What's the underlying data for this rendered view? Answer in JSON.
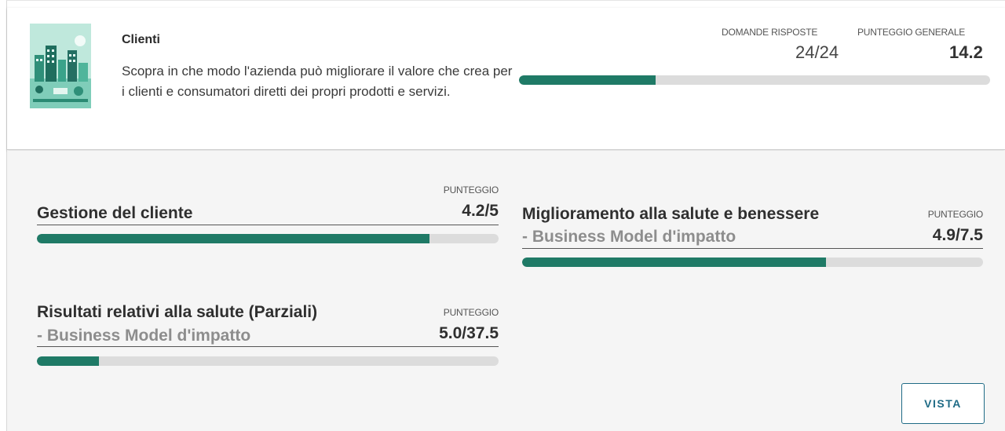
{
  "header": {
    "title": "Clienti",
    "description": "Scopra in che modo l'azienda può migliorare il valore che crea per i clienti e consumatori diretti dei propri prodotti e servizi.",
    "answered_label": "DOMANDE RISPOSTE",
    "answered_value": "24/24",
    "score_label": "PUNTEGGIO GENERALE",
    "score_value": "14.2",
    "progress_fraction": 0.29
  },
  "categories": [
    {
      "title": "Gestione del cliente",
      "subtitle": "",
      "score_label": "PUNTEGGIO",
      "score": "4.2/5",
      "progress_fraction": 0.85
    },
    {
      "title": "Miglioramento alla salute e benessere",
      "subtitle": " - Business Model d'impatto",
      "score_label": "PUNTEGGIO",
      "score": "4.9/7.5",
      "progress_fraction": 0.66
    },
    {
      "title": "Risultati relativi alla salute (Parziali)",
      "subtitle": " - Business Model d'impatto",
      "score_label": "PUNTEGGIO",
      "score": "5.0/37.5",
      "progress_fraction": 0.135
    }
  ],
  "actions": {
    "view_label": "VISTA"
  },
  "colors": {
    "accent": "#1f7a66",
    "track": "#dcdcdc",
    "button": "#1f6b86"
  }
}
